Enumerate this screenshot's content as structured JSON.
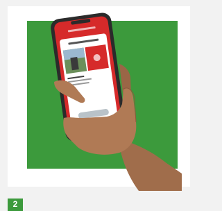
{
  "step": {
    "number": "2"
  },
  "phone_screen": {
    "header_label": "",
    "title": "",
    "caption_lines": [
      "",
      "",
      ""
    ],
    "button_label": ""
  },
  "colors": {
    "green_panel": "#3c9a3c",
    "app_red": "#d62a2a",
    "phone_frame": "#2b2b2b",
    "skin": "#b07a55"
  },
  "icons": [
    "hand-holding-phone-illustration"
  ]
}
